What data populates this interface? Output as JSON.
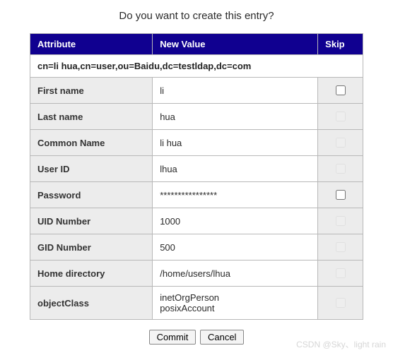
{
  "title": "Do you want to create this entry?",
  "headers": {
    "attribute": "Attribute",
    "new_value": "New Value",
    "skip": "Skip"
  },
  "dn": "cn=li hua,cn=user,ou=Baidu,dc=testldap,dc=com",
  "rows": [
    {
      "attr": "First name",
      "value": "li",
      "skip_enabled": true
    },
    {
      "attr": "Last name",
      "value": "hua",
      "skip_enabled": false
    },
    {
      "attr": "Common Name",
      "value": "li hua",
      "skip_enabled": false
    },
    {
      "attr": "User ID",
      "value": "lhua",
      "skip_enabled": false
    },
    {
      "attr": "Password",
      "value": "****************",
      "skip_enabled": true
    },
    {
      "attr": "UID Number",
      "value": "1000",
      "skip_enabled": false
    },
    {
      "attr": "GID Number",
      "value": "500",
      "skip_enabled": false
    },
    {
      "attr": "Home directory",
      "value": "/home/users/lhua",
      "skip_enabled": false
    },
    {
      "attr": "objectClass",
      "value": "inetOrgPerson\nposixAccount",
      "skip_enabled": false
    }
  ],
  "buttons": {
    "commit": "Commit",
    "cancel": "Cancel"
  },
  "watermark": "CSDN @Sky、light rain"
}
